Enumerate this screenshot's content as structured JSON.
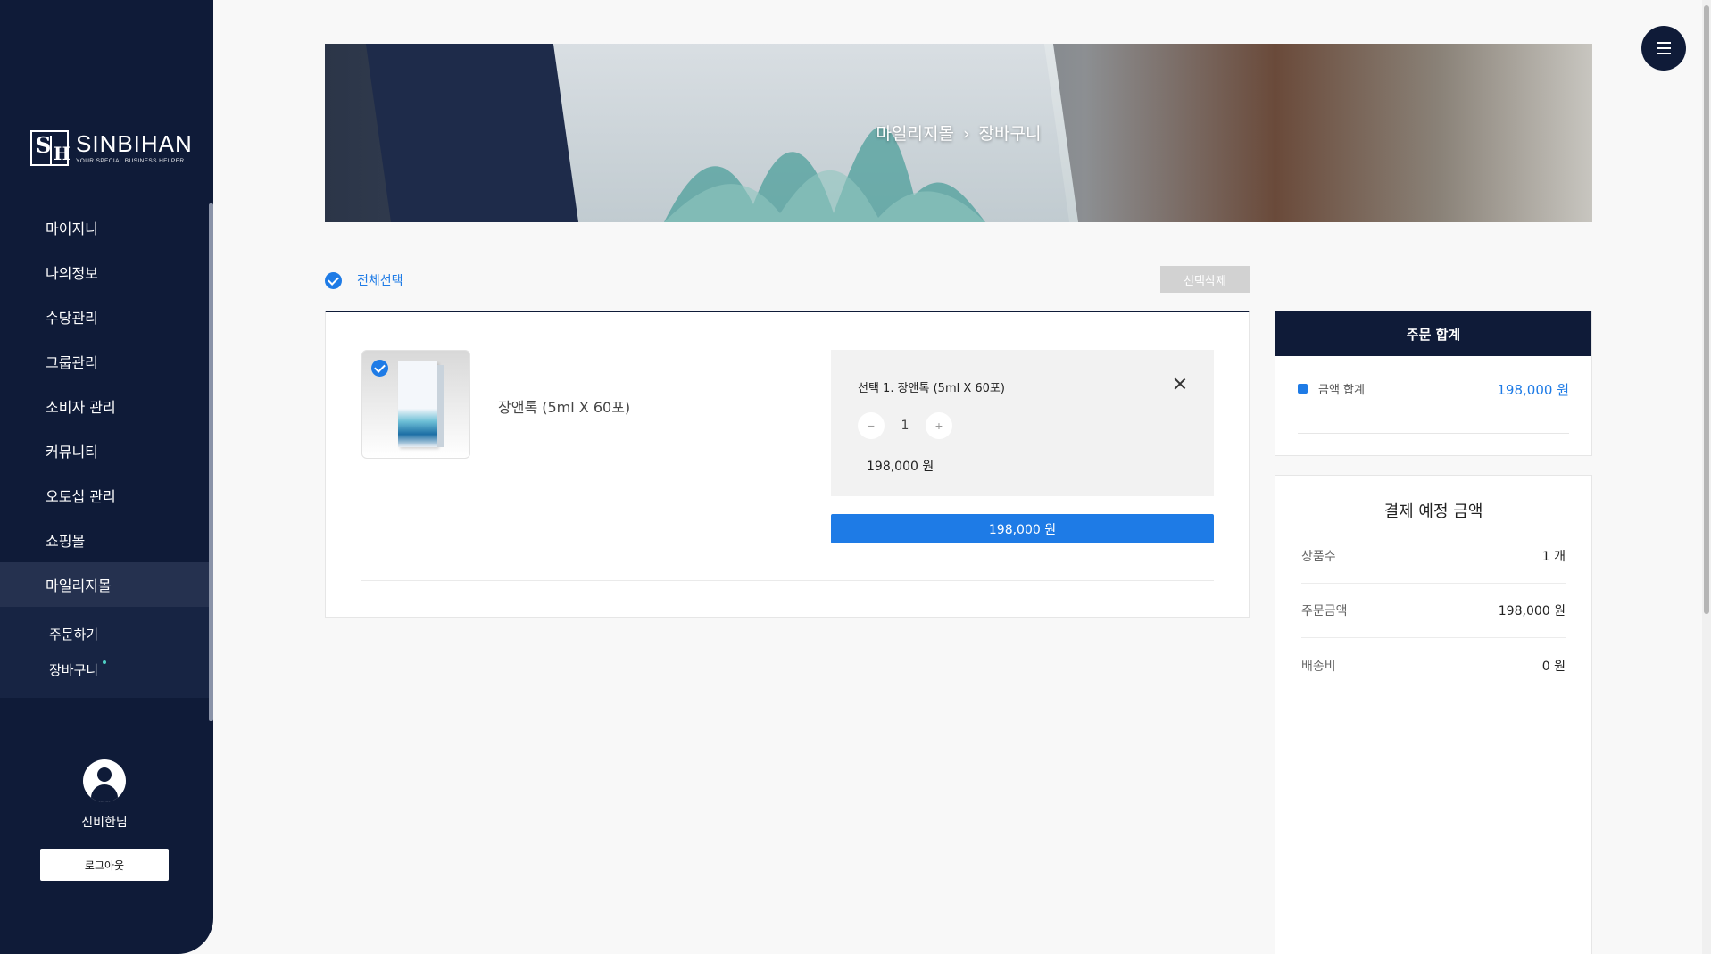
{
  "brand": {
    "name": "SINBIHAN",
    "tagline": "YOUR SPECIAL BUSINESS HELPER"
  },
  "sidebar": {
    "items": [
      {
        "label": "마이지니"
      },
      {
        "label": "나의정보"
      },
      {
        "label": "수당관리"
      },
      {
        "label": "그룹관리"
      },
      {
        "label": "소비자 관리"
      },
      {
        "label": "커뮤니티"
      },
      {
        "label": "오토십 관리"
      },
      {
        "label": "쇼핑몰"
      },
      {
        "label": "마일리지몰"
      }
    ],
    "submenu": [
      {
        "label": "주문하기"
      },
      {
        "label": "장바구니"
      }
    ]
  },
  "user": {
    "name": "신비한님",
    "logout_label": "로그아웃"
  },
  "banner": {
    "crumb_root": "마일리지몰",
    "separator": "›",
    "crumb_current": "장바구니"
  },
  "cart": {
    "select_all_label": "전체선택",
    "delete_selected_label": "선택삭제",
    "item": {
      "name": "장앤톡 (5ml X 60포)",
      "option_title": "선택 1. 장앤톡 (5ml X 60포)",
      "quantity": "1",
      "minus": "−",
      "plus": "+",
      "option_price": "198,000 원",
      "total_label": "198,000 원"
    }
  },
  "summary": {
    "title": "주문 합계",
    "amount_label": "금액 합계",
    "amount_value": "198,000 원"
  },
  "payment": {
    "title": "결제 예정 금액",
    "rows": [
      {
        "label": "상품수",
        "value": "1 개"
      },
      {
        "label": "주문금액",
        "value": "198,000 원"
      },
      {
        "label": "배송비",
        "value": "0 원"
      }
    ]
  },
  "colors": {
    "navy": "#0f1b38",
    "accent": "#1e7be6"
  }
}
